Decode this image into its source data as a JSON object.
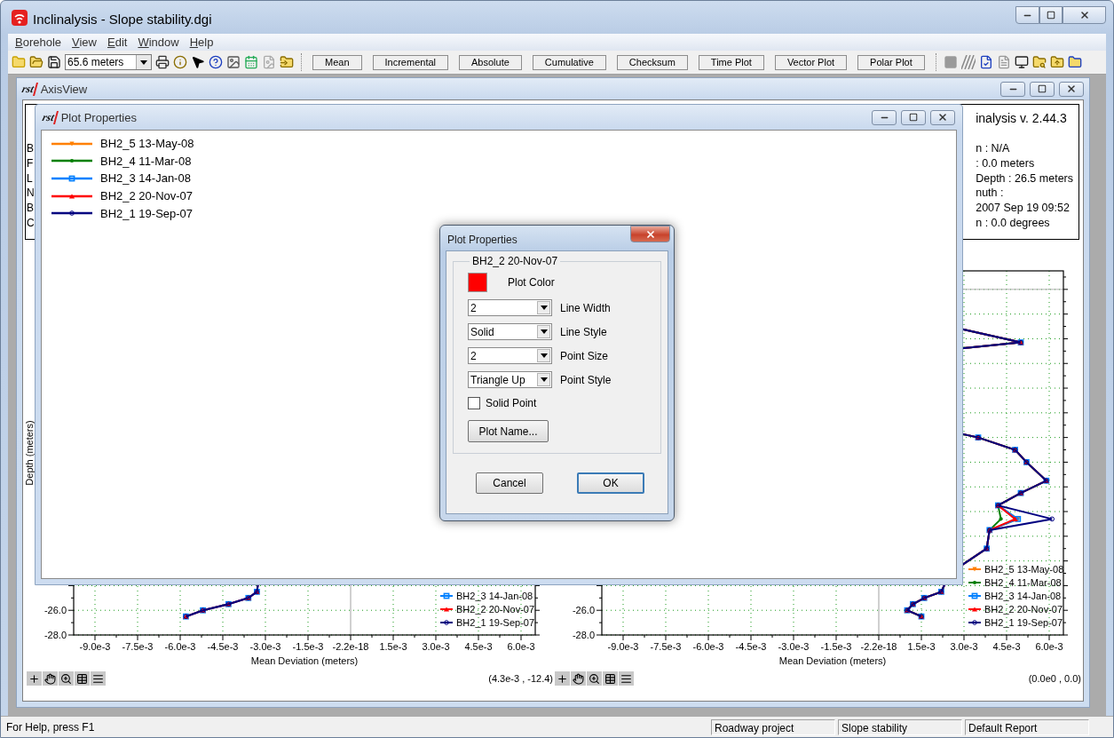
{
  "window": {
    "title": "Inclinalysis - Slope stability.dgi"
  },
  "menu": [
    {
      "label": "Borehole"
    },
    {
      "label": "View"
    },
    {
      "label": "Edit"
    },
    {
      "label": "Window"
    },
    {
      "label": "Help"
    }
  ],
  "toolbar": {
    "depth_select": "65.6 meters",
    "buttons": [
      {
        "label": "Mean"
      },
      {
        "label": "Incremental"
      },
      {
        "label": "Absolute"
      },
      {
        "label": "Cumulative"
      },
      {
        "label": "Checksum"
      },
      {
        "label": "Time Plot"
      },
      {
        "label": "Vector Plot"
      },
      {
        "label": "Polar Plot"
      }
    ]
  },
  "axis_view": {
    "logo": "rst",
    "title": "AxisView",
    "info": {
      "left_lines": [
        "B",
        "F",
        "L",
        "N",
        "B",
        "C"
      ],
      "title": "inalysis v. 2.44.3",
      "right_lines": [
        "n : N/A",
        ": 0.0 meters",
        "Depth : 26.5 meters",
        "nuth :",
        "2007 Sep 19 09:52",
        "n : 0.0 degrees"
      ]
    },
    "plots": [
      {
        "ylabel": "Depth (meters)",
        "y_tick_labels": [
          "-26.0",
          "-28.0"
        ],
        "x_tick_labels": [
          "-9.0e-3",
          "-7.5e-3",
          "-6.0e-3",
          "-4.5e-3",
          "-3.0e-3",
          "-1.5e-3",
          "-2.2e-18",
          "1.5e-3",
          "3.0e-3",
          "4.5e-3",
          "6.0e-3"
        ],
        "xlabel": "Mean Deviation (meters)",
        "legend": [
          {
            "name": "BH2_3 14-Jan-08",
            "color": "#0080ff",
            "kind": "square"
          },
          {
            "name": "BH2_2 20-Nov-07",
            "color": "#ff0000",
            "kind": "triangle_up"
          },
          {
            "name": "BH2_1 19-Sep-07",
            "color": "#000080",
            "kind": "circle"
          }
        ],
        "coordinates": "(4.3e-3 , -12.4)"
      },
      {
        "y_tick_labels": [
          "-26.0",
          "-28.0"
        ],
        "x_tick_labels": [
          "-9.0e-3",
          "-7.5e-3",
          "-6.0e-3",
          "-4.5e-3",
          "-3.0e-3",
          "-1.5e-3",
          "-2.2e-18",
          "1.5e-3",
          "3.0e-3",
          "4.5e-3",
          "6.0e-3"
        ],
        "xlabel": "Mean Deviation (meters)",
        "legend": [
          {
            "name": "BH2_5 13-May-08",
            "color": "#ff8000",
            "kind": "triangle_down"
          },
          {
            "name": "BH2_4 11-Mar-08",
            "color": "#008000",
            "kind": "dot"
          },
          {
            "name": "BH2_3 14-Jan-08",
            "color": "#0080ff",
            "kind": "square"
          },
          {
            "name": "BH2_2 20-Nov-07",
            "color": "#ff0000",
            "kind": "triangle_up"
          },
          {
            "name": "BH2_1 19-Sep-07",
            "color": "#000080",
            "kind": "circle"
          }
        ],
        "coordinates": "(0.0e0 , 0.0)"
      }
    ]
  },
  "plot_properties_window": {
    "logo": "rst",
    "title": "Plot Properties",
    "plots": [
      {
        "name": "BH2_5 13-May-08",
        "color": "#ff8000",
        "kind": "triangle_down"
      },
      {
        "name": "BH2_4 11-Mar-08",
        "color": "#008000",
        "kind": "dot"
      },
      {
        "name": "BH2_3 14-Jan-08",
        "color": "#0080ff",
        "kind": "square"
      },
      {
        "name": "BH2_2 20-Nov-07",
        "color": "#ff0000",
        "kind": "triangle_up"
      },
      {
        "name": "BH2_1 19-Sep-07",
        "color": "#000080",
        "kind": "circle"
      }
    ]
  },
  "dialog": {
    "title": "Plot Properties",
    "group": "BH2_2 20-Nov-07",
    "plot_color": {
      "label": "Plot Color",
      "color": "#ff0000"
    },
    "selects": [
      {
        "value": "2",
        "label": "Line Width"
      },
      {
        "value": "Solid",
        "label": "Line Style"
      },
      {
        "value": "2",
        "label": "Point Size"
      },
      {
        "value": "Triangle Up",
        "label": "Point Style"
      }
    ],
    "checkbox": {
      "label": "Solid Point",
      "checked": false
    },
    "name_button": "Plot Name...",
    "buttons": [
      {
        "label": "Cancel",
        "default": false
      },
      {
        "label": "OK",
        "default": true
      }
    ]
  },
  "status_bar": {
    "help": "For Help, press F1",
    "panes": [
      "Roadway project",
      "Slope stability",
      "Default Report"
    ]
  }
}
